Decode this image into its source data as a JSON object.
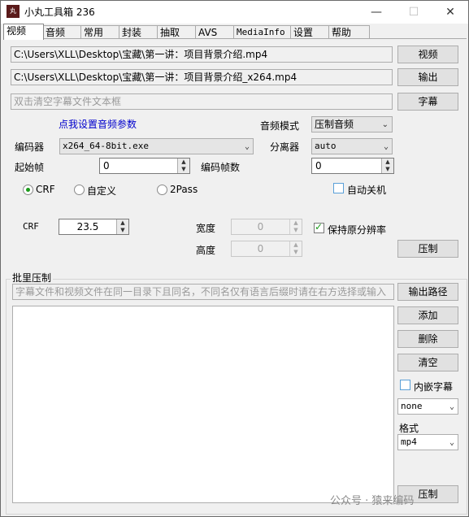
{
  "window": {
    "title": "小丸工具箱 236",
    "icon_text": "丸"
  },
  "tabs": [
    "视频",
    "音频",
    "常用",
    "封装",
    "抽取",
    "AVS",
    "MediaInfo",
    "设置",
    "帮助"
  ],
  "video": {
    "input_path": "C:\\Users\\XLL\\Desktop\\宝藏\\第一讲：项目背景介绍.mp4",
    "output_path": "C:\\Users\\XLL\\Desktop\\宝藏\\第一讲：项目背景介绍_x264.mp4",
    "subtitle_placeholder": "双击清空字幕文件文本框",
    "video_button": "视频",
    "output_button": "输出",
    "subtitle_button": "字幕",
    "audio_link": "点我设置音频参数",
    "audio_mode_label": "音频模式",
    "audio_mode_value": "压制音频",
    "encoder_label": "编码器",
    "encoder_value": "x264_64-8bit.exe",
    "splitter_label": "分离器",
    "splitter_value": "auto",
    "start_frame_label": "起始帧",
    "start_frame_value": "0",
    "encode_frames_label": "编码帧数",
    "encode_frames_value": "0",
    "mode_crf": "CRF",
    "mode_custom": "自定义",
    "mode_2pass": "2Pass",
    "auto_shutdown": "自动关机",
    "crf_label": "CRF",
    "crf_value": "23.5",
    "width_label": "宽度",
    "width_value": "0",
    "height_label": "高度",
    "height_value": "0",
    "keep_resolution": "保持原分辨率",
    "encode_button": "压制"
  },
  "batch": {
    "group_label": "批里压制",
    "hint": "字幕文件和视频文件在同一目录下且同名，不同名仅有语言后缀时请在右方选择或输入",
    "output_path_button": "输出路径",
    "add_button": "添加",
    "delete_button": "删除",
    "clear_button": "清空",
    "embed_subtitle": "内嵌字幕",
    "subtitle_lang_value": "none",
    "format_label": "格式",
    "format_value": "mp4",
    "encode_button": "压制"
  },
  "watermark": "公众号 · 猿来编码"
}
